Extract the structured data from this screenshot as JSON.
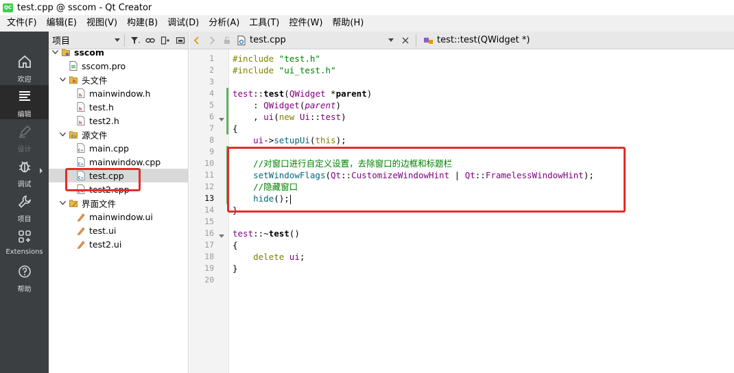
{
  "window": {
    "title": "test.cpp @ sscom - Qt Creator",
    "app_icon": "QC"
  },
  "menu": [
    {
      "label": "文件(F)"
    },
    {
      "label": "编辑(E)"
    },
    {
      "label": "视图(V)"
    },
    {
      "label": "构建(B)"
    },
    {
      "label": "调试(D)"
    },
    {
      "label": "分析(A)"
    },
    {
      "label": "工具(T)"
    },
    {
      "label": "控件(W)"
    },
    {
      "label": "帮助(H)"
    }
  ],
  "modes": [
    {
      "label": "欢迎",
      "icon": "home-icon"
    },
    {
      "label": "编辑",
      "icon": "edit-icon",
      "active": true
    },
    {
      "label": "设计",
      "icon": "design-icon",
      "disabled": true
    },
    {
      "label": "调试",
      "icon": "debug-icon"
    },
    {
      "label": "项目",
      "icon": "wrench-icon"
    },
    {
      "label": "Extensions",
      "icon": "extensions-icon"
    },
    {
      "label": "帮助",
      "icon": "help-icon"
    }
  ],
  "project": {
    "panel_label": "项目",
    "tree": [
      {
        "label": "sscom",
        "type": "project",
        "depth": 0,
        "expanded": true
      },
      {
        "label": "sscom.pro",
        "type": "pro",
        "depth": 1
      },
      {
        "label": "头文件",
        "type": "folder-h",
        "depth": 1,
        "expanded": true
      },
      {
        "label": "mainwindow.h",
        "type": "h",
        "depth": 2
      },
      {
        "label": "test.h",
        "type": "h",
        "depth": 2
      },
      {
        "label": "test2.h",
        "type": "h",
        "depth": 2
      },
      {
        "label": "源文件",
        "type": "folder-cpp",
        "depth": 1,
        "expanded": true
      },
      {
        "label": "main.cpp",
        "type": "cpp",
        "depth": 2
      },
      {
        "label": "mainwindow.cpp",
        "type": "cpp",
        "depth": 2
      },
      {
        "label": "test.cpp",
        "type": "cpp",
        "depth": 2,
        "selected": true
      },
      {
        "label": "test2.cpp",
        "type": "cpp",
        "depth": 2
      },
      {
        "label": "界面文件",
        "type": "folder-ui",
        "depth": 1,
        "expanded": true
      },
      {
        "label": "mainwindow.ui",
        "type": "ui",
        "depth": 2
      },
      {
        "label": "test.ui",
        "type": "ui",
        "depth": 2
      },
      {
        "label": "test2.ui",
        "type": "ui",
        "depth": 2
      }
    ]
  },
  "editor": {
    "open_file": "test.cpp",
    "current_function": "test::test(QWidget *)",
    "current_line": 13,
    "lines": [
      {
        "num": "1",
        "tokens": [
          {
            "t": "#include ",
            "c": "kw"
          },
          {
            "t": "\"test.h\"",
            "c": "str"
          }
        ]
      },
      {
        "num": "2",
        "tokens": [
          {
            "t": "#include ",
            "c": "kw"
          },
          {
            "t": "\"ui_test.h\"",
            "c": "str"
          }
        ]
      },
      {
        "num": "3",
        "tokens": []
      },
      {
        "num": "4",
        "tokens": [
          {
            "t": "test",
            "c": "cls"
          },
          {
            "t": "::",
            "c": "punct"
          },
          {
            "t": "test",
            "c": "bold"
          },
          {
            "t": "(",
            "c": "punct"
          },
          {
            "t": "QWidget",
            "c": "cls"
          },
          {
            "t": " *",
            "c": "punct"
          },
          {
            "t": "parent",
            "c": "bold"
          },
          {
            "t": ")",
            "c": "punct"
          }
        ]
      },
      {
        "num": "5",
        "tokens": [
          {
            "t": "    : ",
            "c": "punct"
          },
          {
            "t": "QWidget",
            "c": "cls"
          },
          {
            "t": "(",
            "c": "punct"
          },
          {
            "t": "parent",
            "c": "it cls"
          },
          {
            "t": ")",
            "c": "punct"
          }
        ]
      },
      {
        "num": "6",
        "tokens": [
          {
            "t": "    , ",
            "c": "punct"
          },
          {
            "t": "ui",
            "c": "cls"
          },
          {
            "t": "(",
            "c": "punct"
          },
          {
            "t": "new",
            "c": "kw"
          },
          {
            "t": " ",
            "c": "punct"
          },
          {
            "t": "Ui",
            "c": "cls"
          },
          {
            "t": "::",
            "c": "punct"
          },
          {
            "t": "test",
            "c": "cls"
          },
          {
            "t": ")",
            "c": "punct"
          }
        ]
      },
      {
        "num": "7",
        "tokens": [
          {
            "t": "{",
            "c": "punct"
          }
        ]
      },
      {
        "num": "8",
        "tokens": [
          {
            "t": "    ",
            "c": "punct"
          },
          {
            "t": "ui",
            "c": "cls"
          },
          {
            "t": "->",
            "c": "punct"
          },
          {
            "t": "setupUi",
            "c": "fn"
          },
          {
            "t": "(",
            "c": "punct"
          },
          {
            "t": "this",
            "c": "kw"
          },
          {
            "t": ");",
            "c": "punct"
          }
        ]
      },
      {
        "num": "9",
        "tokens": []
      },
      {
        "num": "10",
        "tokens": [
          {
            "t": "    //对窗口进行自定义设置，去除窗口的边框和标题栏",
            "c": "cmt"
          }
        ]
      },
      {
        "num": "11",
        "tokens": [
          {
            "t": "    ",
            "c": "punct"
          },
          {
            "t": "setWindowFlags",
            "c": "fn"
          },
          {
            "t": "(",
            "c": "punct"
          },
          {
            "t": "Qt",
            "c": "cls"
          },
          {
            "t": "::",
            "c": "punct"
          },
          {
            "t": "CustomizeWindowHint",
            "c": "cls"
          },
          {
            "t": " | ",
            "c": "punct"
          },
          {
            "t": "Qt",
            "c": "cls"
          },
          {
            "t": "::",
            "c": "punct"
          },
          {
            "t": "FramelessWindowHint",
            "c": "cls"
          },
          {
            "t": ");",
            "c": "punct"
          }
        ]
      },
      {
        "num": "12",
        "tokens": [
          {
            "t": "    //隐藏窗口",
            "c": "cmt"
          }
        ]
      },
      {
        "num": "13",
        "tokens": [
          {
            "t": "    ",
            "c": "punct"
          },
          {
            "t": "hide",
            "c": "fn"
          },
          {
            "t": "();",
            "c": "punct"
          }
        ],
        "cursor": true
      },
      {
        "num": "14",
        "tokens": [
          {
            "t": "}",
            "c": "punct"
          }
        ]
      },
      {
        "num": "15",
        "tokens": []
      },
      {
        "num": "16",
        "tokens": [
          {
            "t": "test",
            "c": "cls"
          },
          {
            "t": "::~",
            "c": "punct"
          },
          {
            "t": "test",
            "c": "bold"
          },
          {
            "t": "()",
            "c": "punct"
          }
        ]
      },
      {
        "num": "17",
        "tokens": [
          {
            "t": "{",
            "c": "punct"
          }
        ]
      },
      {
        "num": "18",
        "tokens": [
          {
            "t": "    ",
            "c": "punct"
          },
          {
            "t": "delete",
            "c": "kw"
          },
          {
            "t": " ",
            "c": "punct"
          },
          {
            "t": "ui",
            "c": "cls"
          },
          {
            "t": ";",
            "c": "punct"
          }
        ]
      },
      {
        "num": "19",
        "tokens": [
          {
            "t": "}",
            "c": "punct"
          }
        ]
      },
      {
        "num": "20",
        "tokens": []
      }
    ]
  },
  "colors": {
    "annotation_red": "#e42b2b",
    "change_bar_green": "#5fb35f",
    "sidebar_dark": "#3c3f41",
    "keyword": "#808000",
    "string": "#008000",
    "class": "#800080",
    "function": "#00677c"
  }
}
